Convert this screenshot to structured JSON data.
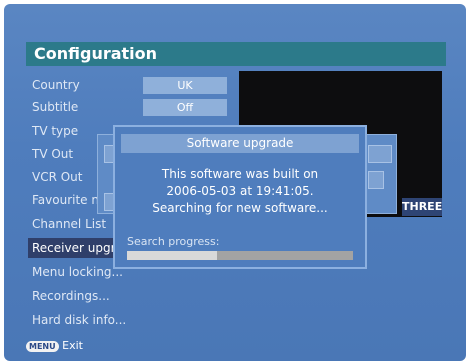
{
  "header": {
    "title": "Configuration"
  },
  "menu": {
    "items": [
      {
        "label": "Country"
      },
      {
        "label": "Subtitle"
      },
      {
        "label": "TV type"
      },
      {
        "label": "TV Out"
      },
      {
        "label": "VCR Out"
      },
      {
        "label": "Favourite n"
      },
      {
        "label": "Channel List"
      },
      {
        "label": "Receiver upgr"
      },
      {
        "label": "Menu locking..."
      },
      {
        "label": "Recordings..."
      },
      {
        "label": "Hard disk info..."
      }
    ],
    "values": {
      "country": "UK",
      "subtitle": "Off"
    }
  },
  "preview": {
    "channel_label": "THREE"
  },
  "dialog": {
    "title": "Software upgrade",
    "line1": "This software was built on",
    "line2": "2006-05-03 at 19:41:05.",
    "line3": "Searching for new software...",
    "progress_label": "Search progress:",
    "progress_fraction": 0.4
  },
  "footer": {
    "key_label": "MENU",
    "exit_label": "Exit"
  },
  "colors": {
    "title_bar": "#2c7a8a",
    "selected_item": "#2f3f6a",
    "background": "#4f7dbd"
  }
}
